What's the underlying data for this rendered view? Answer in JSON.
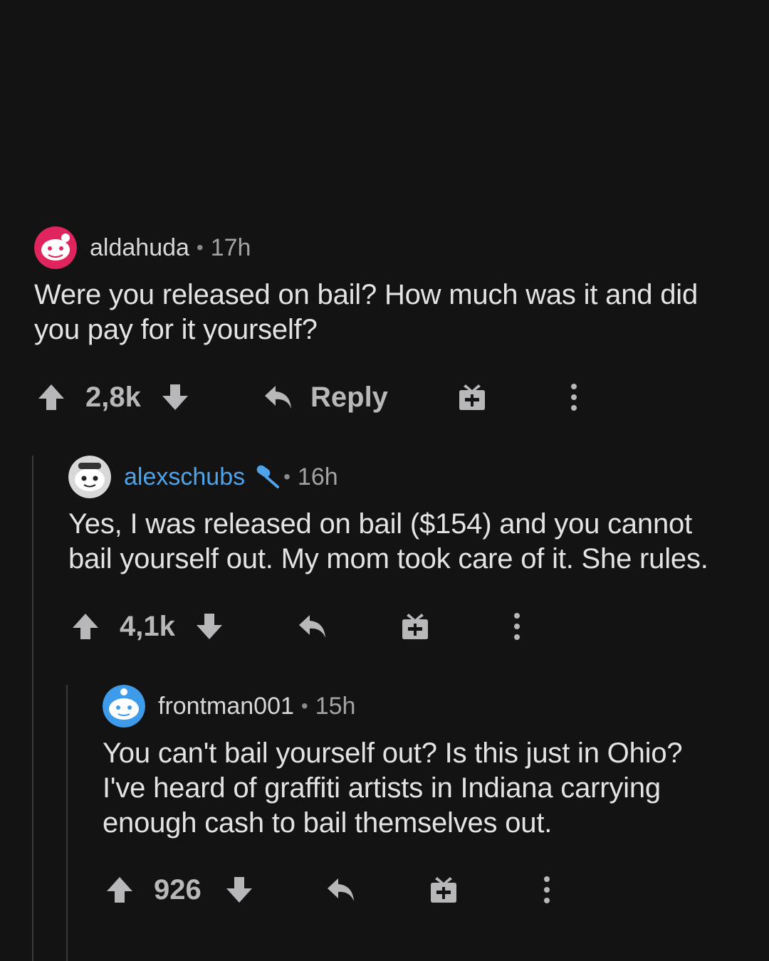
{
  "comments": [
    {
      "username": "aldahuda",
      "separator": "•",
      "time": "17h",
      "body": "Were you released on bail? How much was it and did\nyou pay for it yourself?",
      "score": "2,8k",
      "reply_label": "Reply",
      "avatar_color": "#e0245e"
    },
    {
      "username": "alexschubs",
      "separator": "•",
      "time": "16h",
      "body": "Yes, I was released on bail ($154) and you cannot\nbail yourself out. My mom took care of it. She rules.",
      "score": "4,1k",
      "is_op": true,
      "badge_icon": "microphone-icon",
      "avatar_color": "#d8d8d8"
    },
    {
      "username": "frontman001",
      "separator": "•",
      "time": "15h",
      "body": "You can't bail yourself out? Is this just in Ohio?\nI've heard of graffiti artists in Indiana carrying\nenough cash to bail themselves out.",
      "score": "926",
      "avatar_color": "#3d9be9"
    }
  ],
  "icons": [
    "upvote-icon",
    "downvote-icon",
    "reply-icon",
    "award-icon",
    "more-options-icon",
    "microphone-icon"
  ],
  "colors": {
    "background": "#131314",
    "op_username": "#4fa3e8",
    "text": "#e3e3e4",
    "muted": "#a3a3a5",
    "thread_line": "#3a3a3c"
  }
}
